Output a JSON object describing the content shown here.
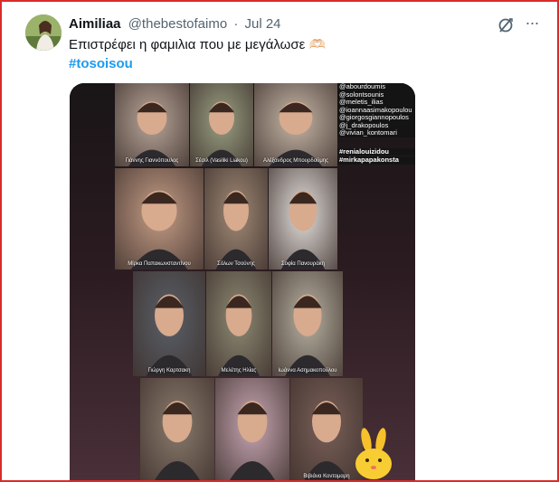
{
  "tweet": {
    "display_name": "Aimiliaa",
    "handle": "@thebestofaimo",
    "separator": "·",
    "date": "Jul 24",
    "text": "Επιστρέφει η φαμιλια που με μεγάλωσε 🫶🏻",
    "hashtag": "#tosoisou",
    "more_label": "···"
  },
  "media": {
    "mentions": [
      "@abourdoumis",
      "@solontsounis",
      "@meletis_ilias",
      "@ioannaasimakopoulou",
      "@giorgosgiannopoulos",
      "@j_drakopoulos",
      "@vivian_kontomari"
    ],
    "hashtags": [
      "#renialouizidou",
      "#mirkapapakonsta"
    ],
    "tiles": [
      {
        "label": "Γιάννης Γιαννόπουλος",
        "color": "#b9a79a"
      },
      {
        "label": "Σέσιλ (Vasiliki Liakou)",
        "color": "#9aa083"
      },
      {
        "label": "Αλέξανδρος Μπουρδούμης",
        "color": "#c7b8a8"
      },
      {
        "label": "Μίρκα Παπακωνσταντίνου",
        "color": "#c59d86"
      },
      {
        "label": "Σόλων Τσούνης",
        "color": "#a08a76"
      },
      {
        "label": "Σοφία Πανουράκη",
        "color": "#e4e0dc"
      },
      {
        "label": "Γιώργη Καρτσακη",
        "color": "#5a6068"
      },
      {
        "label": "Μελέτης Ηλίας",
        "color": "#8e8a74"
      },
      {
        "label": "Ιωάννα Ασημακοπούλου",
        "color": "#b8b2a2"
      },
      {
        "label": "",
        "color": "#8a7b6d"
      },
      {
        "label": "",
        "color": "#c8a7b4"
      },
      {
        "label": "Βιβιάνα Κοντομαρη",
        "color": "#7a6058"
      }
    ]
  }
}
